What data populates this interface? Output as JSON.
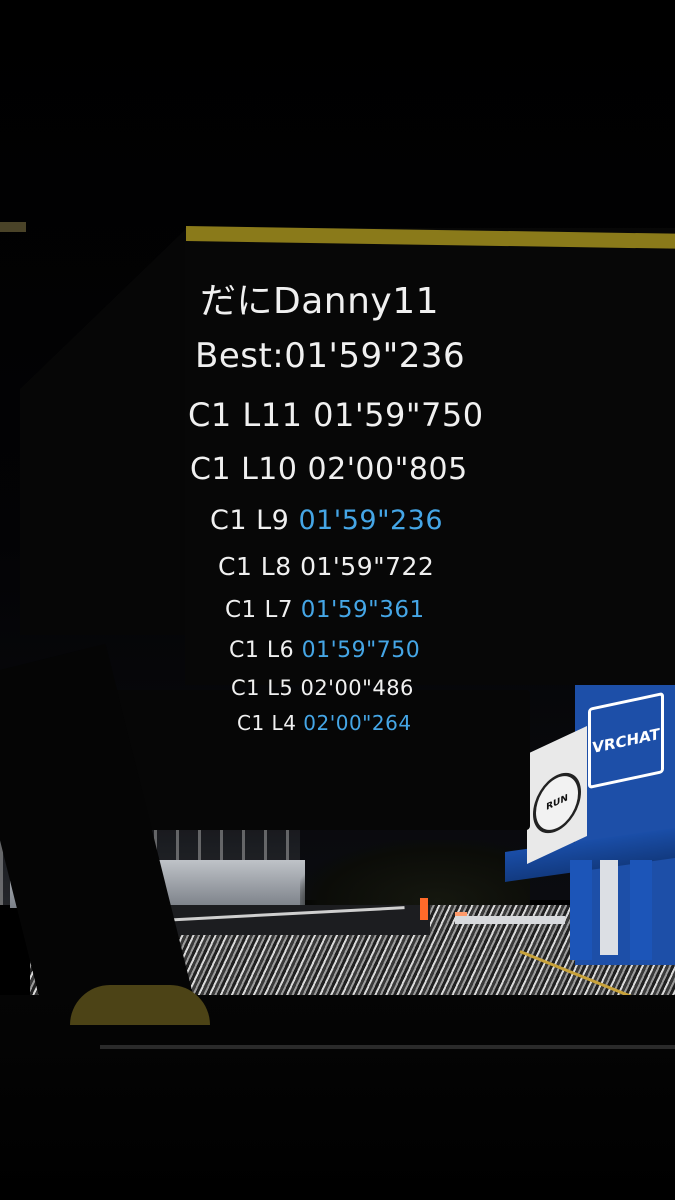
{
  "scene": {
    "sign_text": "VRCHAT",
    "wall_logo_text": "RUN"
  },
  "leaderboard": {
    "player": "だにDanny11",
    "best": "Best:01'59\"236",
    "laps": [
      {
        "label": "C1 L11",
        "time": "01'59\"750",
        "highlight": false
      },
      {
        "label": "C1 L10",
        "time": "02'00\"805",
        "highlight": false
      },
      {
        "label": "C1 L9",
        "time": "01'59\"236",
        "highlight": true
      },
      {
        "label": "C1 L8",
        "time": "01'59\"722",
        "highlight": false
      },
      {
        "label": "C1 L7",
        "time": "01'59\"361",
        "highlight": true
      },
      {
        "label": "C1 L6",
        "time": "01'59\"750",
        "highlight": true
      },
      {
        "label": "C1 L5",
        "time": "02'00\"486",
        "highlight": false
      },
      {
        "label": "C1 L4",
        "time": "02'00\"264",
        "highlight": true
      }
    ]
  },
  "colors": {
    "text": "#f0f0f0",
    "highlight": "#45a6e6",
    "panel": "#070707",
    "panel_accent": "#8a7a1a",
    "building_blue": "#1d4fa8"
  }
}
